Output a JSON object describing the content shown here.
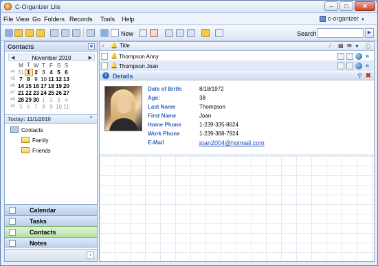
{
  "window": {
    "title": "C-Organizer Lite"
  },
  "menu": {
    "items": [
      "File",
      "View",
      "Go",
      "Folders",
      "Records",
      "Tools",
      "Help"
    ],
    "organizer": "c-organizer"
  },
  "toolbar": {
    "new_label": "New",
    "search_label": "Search:",
    "search_value": ""
  },
  "left_panel": {
    "header": "Contacts",
    "calendar": {
      "month_title": "November 2010",
      "weekdays": [
        "M",
        "T",
        "W",
        "T",
        "F",
        "S",
        "S"
      ],
      "weeks": [
        {
          "wk": "44",
          "days": [
            "31",
            "1",
            "2",
            "3",
            "4",
            "5",
            "6"
          ]
        },
        {
          "wk": "45",
          "days": [
            "7",
            "8",
            "9",
            "10",
            "11",
            "12",
            "13"
          ]
        },
        {
          "wk": "46",
          "days": [
            "14",
            "15",
            "16",
            "17",
            "18",
            "19",
            "20"
          ]
        },
        {
          "wk": "47",
          "days": [
            "21",
            "22",
            "23",
            "24",
            "25",
            "26",
            "27"
          ]
        },
        {
          "wk": "48",
          "days": [
            "28",
            "29",
            "30",
            "1",
            "2",
            "3",
            "4"
          ]
        },
        {
          "wk": "49",
          "days": [
            "5",
            "6",
            "7",
            "8",
            "9",
            "10",
            "11"
          ]
        }
      ]
    },
    "today_label": "Today: 11/1/2010",
    "tree": {
      "root": "Contacts",
      "children": [
        "Family",
        "Friends"
      ]
    },
    "nav": [
      "Calendar",
      "Tasks",
      "Contacts",
      "Notes"
    ]
  },
  "grid": {
    "columns": {
      "title": "Title"
    },
    "rows": [
      {
        "name": "Thompson Anny"
      },
      {
        "name": "Thompson Joan"
      }
    ]
  },
  "details": {
    "label": "Details",
    "fields": [
      {
        "label": "Date of Birth:",
        "value": "8/18/1972"
      },
      {
        "label": "Age:",
        "value": "38"
      },
      {
        "label": "Last Name",
        "value": "Thompson"
      },
      {
        "label": "First Name",
        "value": "Joan"
      },
      {
        "label": "Home Phone",
        "value": "1-239-335-8624"
      },
      {
        "label": "Work Phone",
        "value": "1-239-368-7924"
      },
      {
        "label": "E-Mail",
        "value": "joan2004@hotmail.com"
      }
    ]
  }
}
